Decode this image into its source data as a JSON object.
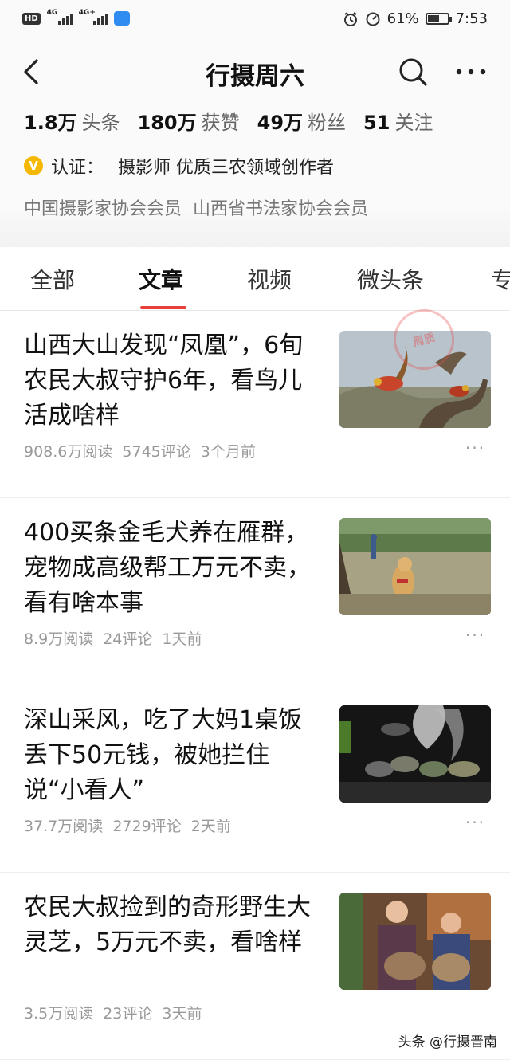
{
  "status_bar": {
    "hd_label": "HD",
    "signal_1": "4G",
    "signal_2": "4G+",
    "battery_percent": "61%",
    "battery_level": 0.61,
    "time": "7:53"
  },
  "nav": {
    "title": "行摄周六"
  },
  "stats": [
    {
      "num": "1.8万",
      "label": "头条"
    },
    {
      "num": "180万",
      "label": "获赞"
    },
    {
      "num": "49万",
      "label": "粉丝"
    },
    {
      "num": "51",
      "label": "关注"
    }
  ],
  "verification": {
    "badge": "V",
    "label": "认证：",
    "text": "摄影师 优质三农领域创作者"
  },
  "memberships": "中国摄影家协会会员  山西省书法家协会会员",
  "tabs": [
    "全部",
    "文章",
    "视频",
    "微头条",
    "专"
  ],
  "active_tab": "文章",
  "stamp_text": "周质",
  "articles": [
    {
      "title": "山西大山发现“凤凰”，6旬农民大叔守护6年，看鸟儿活成啥样",
      "reads": "908.6万阅读",
      "comments": "5745评论",
      "time": "3个月前",
      "thumb": "pheasants-on-stump"
    },
    {
      "title": "400买条金毛犬养在雁群，宠物成高级帮工万元不卖，看有啥本事",
      "reads": "8.9万阅读",
      "comments": "24评论",
      "time": "1天前",
      "thumb": "golden-retriever-running"
    },
    {
      "title": "深山采风，吃了大妈1桌饭丢下50元钱，被她拦住说“小看人”",
      "reads": "37.7万阅读",
      "comments": "2729评论",
      "time": "2天前",
      "thumb": "steaming-dinner-table"
    },
    {
      "title": "农民大叔捡到的奇形野生大灵芝，5万元不卖，看啥样",
      "reads": "3.5万阅读",
      "comments": "23评论",
      "time": "3天前",
      "thumb": "couple-holding-lingzhi"
    }
  ],
  "more_label": "···",
  "watermark": "头条 @行摄晋南"
}
